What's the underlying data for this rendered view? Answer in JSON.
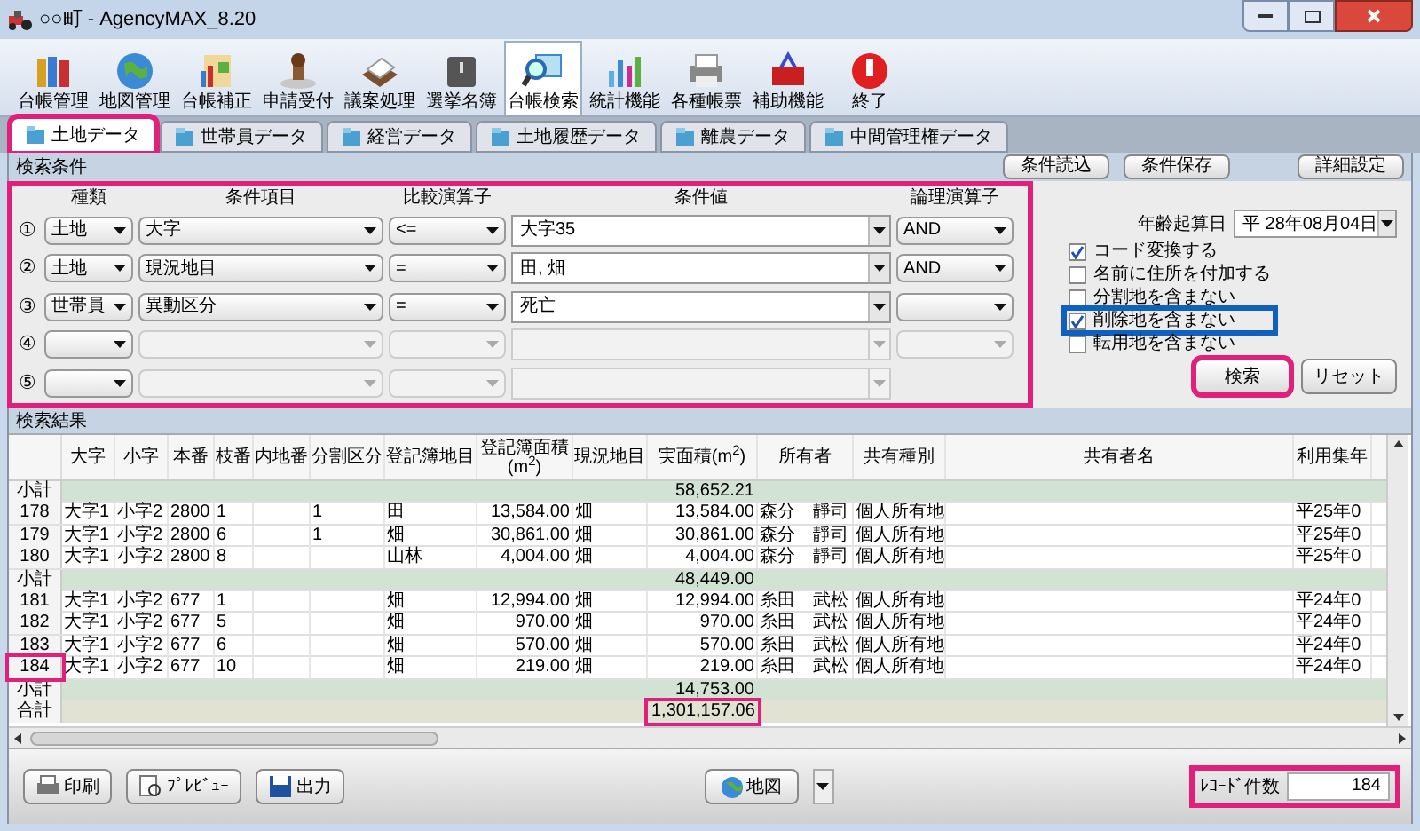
{
  "window": {
    "title": "○○町 - AgencyMAX_8.20"
  },
  "toolbar": [
    {
      "label": "台帳管理",
      "selected": false
    },
    {
      "label": "地図管理",
      "selected": false
    },
    {
      "label": "台帳補正",
      "selected": false
    },
    {
      "label": "申請受付",
      "selected": false
    },
    {
      "label": "議案処理",
      "selected": false
    },
    {
      "label": "選挙名簿",
      "selected": false
    },
    {
      "label": "台帳検索",
      "selected": true
    },
    {
      "label": "統計機能",
      "selected": false
    },
    {
      "label": "各種帳票",
      "selected": false
    },
    {
      "label": "補助機能",
      "selected": false
    },
    {
      "label": "終了",
      "selected": false
    }
  ],
  "tabs": [
    {
      "label": "土地データ",
      "selected": true,
      "highlighted": true
    },
    {
      "label": "世帯員データ",
      "selected": false,
      "highlighted": false
    },
    {
      "label": "経営データ",
      "selected": false,
      "highlighted": false
    },
    {
      "label": "土地履歴データ",
      "selected": false,
      "highlighted": false
    },
    {
      "label": "離農データ",
      "selected": false,
      "highlighted": false
    },
    {
      "label": "中間管理権データ",
      "selected": false,
      "highlighted": false
    }
  ],
  "conditions": {
    "title": "検索条件",
    "buttons": [
      "条件読込",
      "条件保存",
      "詳細設定"
    ],
    "highlighted": true,
    "headers": [
      "種類",
      "条件項目",
      "比較演算子",
      "条件値",
      "論理演算子"
    ],
    "rows": [
      {
        "number": "①",
        "type": "土地",
        "item": "大字",
        "operator": "<=",
        "value": "大字35",
        "logic": "AND",
        "enabled": true,
        "logic_field": true
      },
      {
        "number": "②",
        "type": "土地",
        "item": "現況地目",
        "operator": "=",
        "value": "田, 畑",
        "logic": "AND",
        "enabled": true,
        "logic_field": true
      },
      {
        "number": "③",
        "type": "世帯員",
        "item": "異動区分",
        "operator": "=",
        "value": "死亡",
        "enabled": true,
        "logic_field": true
      },
      {
        "number": "④",
        "enabled": false,
        "logic_field": true
      },
      {
        "number": "⑤",
        "enabled": false,
        "logic_field": false
      }
    ]
  },
  "options": {
    "date_label": "年齢起算日",
    "date": "平 28年08月04日",
    "checkboxes": [
      {
        "label": "コード変換する",
        "checked": true,
        "highlighted": false
      },
      {
        "label": "名前に住所を付加する",
        "checked": false,
        "highlighted": false
      },
      {
        "label": "分割地を含まない",
        "checked": false,
        "highlighted": false
      },
      {
        "label": "削除地を含まない",
        "checked": true,
        "highlighted": true
      },
      {
        "label": "転用地を含まない",
        "checked": false,
        "highlighted": false
      }
    ],
    "search_button": {
      "label": "検索",
      "highlighted": true
    },
    "reset_button": "リセット"
  },
  "results": {
    "title": "検索結果",
    "columns": [
      "大字",
      "小字",
      "本番",
      "枝番",
      "内地番",
      "分割区分",
      "登記簿地目",
      "登記簿面積(m$^{2}$)",
      "現況地目",
      "実面積(m$^{2}$)",
      "所有者",
      "共有種別",
      "共有者名",
      "利用集年"
    ],
    "rows": [
      {
        "kind": "subtotal",
        "label": "小計",
        "value": "58,652.21",
        "highlighted": false
      },
      {
        "kind": "data",
        "number": "178",
        "highlighted": false,
        "cells": [
          "大字1",
          "小字2",
          "2800",
          "1",
          null,
          "1",
          "田",
          "13,584.00",
          "畑",
          "13,584.00",
          "森分　靜司",
          "個人所有地",
          null,
          "平25年0"
        ]
      },
      {
        "kind": "data",
        "number": "179",
        "highlighted": false,
        "cells": [
          "大字1",
          "小字2",
          "2800",
          "6",
          null,
          "1",
          "畑",
          "30,861.00",
          "畑",
          "30,861.00",
          "森分　靜司",
          "個人所有地",
          null,
          "平25年0"
        ]
      },
      {
        "kind": "data",
        "number": "180",
        "highlighted": false,
        "cells": [
          "大字1",
          "小字2",
          "2800",
          "8",
          null,
          null,
          "山林",
          "4,004.00",
          "畑",
          "4,004.00",
          "森分　靜司",
          "個人所有地",
          null,
          "平25年0"
        ]
      },
      {
        "kind": "subtotal",
        "label": "小計",
        "value": "48,449.00",
        "highlighted": false
      },
      {
        "kind": "data",
        "number": "181",
        "highlighted": false,
        "cells": [
          "大字1",
          "小字2",
          "677",
          "1",
          null,
          null,
          "畑",
          "12,994.00",
          "畑",
          "12,994.00",
          "糸田　武松",
          "個人所有地",
          null,
          "平24年0"
        ]
      },
      {
        "kind": "data",
        "number": "182",
        "highlighted": false,
        "cells": [
          "大字1",
          "小字2",
          "677",
          "5",
          null,
          null,
          "畑",
          "970.00",
          "畑",
          "970.00",
          "糸田　武松",
          "個人所有地",
          null,
          "平24年0"
        ]
      },
      {
        "kind": "data",
        "number": "183",
        "highlighted": false,
        "cells": [
          "大字1",
          "小字2",
          "677",
          "6",
          null,
          null,
          "畑",
          "570.00",
          "畑",
          "570.00",
          "糸田　武松",
          "個人所有地",
          null,
          "平24年0"
        ]
      },
      {
        "kind": "data",
        "number": "184",
        "highlighted": true,
        "cells": [
          "大字1",
          "小字2",
          "677",
          "10",
          null,
          null,
          "畑",
          "219.00",
          "畑",
          "219.00",
          "糸田　武松",
          "個人所有地",
          null,
          "平24年0"
        ]
      },
      {
        "kind": "subtotal",
        "label": "小計",
        "value": "14,753.00",
        "highlighted": false
      },
      {
        "kind": "total",
        "label": "合計",
        "value": "1,301,157.06",
        "highlighted": true
      }
    ]
  },
  "footer": {
    "buttons": [
      "印刷",
      "ﾌﾟﾚﾋﾞｭｰ",
      "出力"
    ],
    "map_button": "地図",
    "record_label": "ﾚｺｰﾄﾞ件数",
    "record_count": "184",
    "highlighted": true
  }
}
